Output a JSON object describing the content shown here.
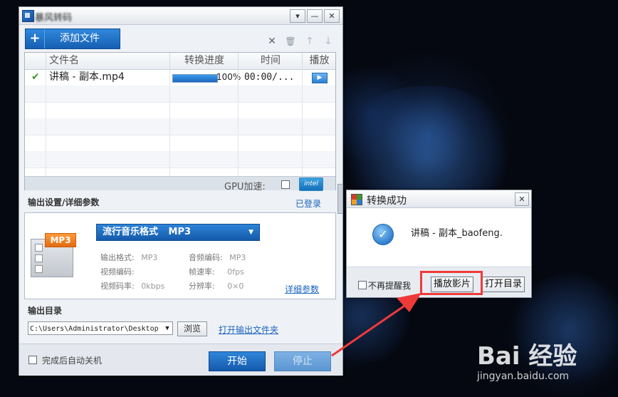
{
  "main_window": {
    "title": "暴风转码",
    "controls": {
      "menu": "▾",
      "minimize": "—",
      "close": "✕"
    },
    "toolbar": {
      "add_plus": "+",
      "add_label": "添加文件",
      "remove_icon": "✕",
      "delete_icon": "🗑",
      "up_icon": "↑",
      "down_icon": "↓"
    },
    "list": {
      "columns": [
        "文件名",
        "转换进度",
        "时间",
        "播放"
      ],
      "rows": [
        {
          "check": "✔",
          "filename": "讲稿 - 副本.mp4",
          "progress_percent": 100,
          "progress_label": "100%",
          "time": "00:00/...",
          "play": "▶"
        }
      ],
      "gpu_label": "GPU加速:",
      "gpu_checked": false,
      "intel_label": "intel"
    },
    "output_settings": {
      "title": "输出设置/详细参数",
      "login_link": "已登录",
      "format_name": "流行音乐格式",
      "format_code": "MP3",
      "format_arrow": "▼",
      "icon_tag": "MP3",
      "params": {
        "output_format_label": "输出格式:",
        "output_format_value": "MP3",
        "audio_codec_label": "音频编码:",
        "audio_codec_value": "MP3",
        "video_codec_label": "视频编码:",
        "video_codec_value": "",
        "frame_rate_label": "帧速率:",
        "frame_rate_value": "0fps",
        "video_bitrate_label": "视频码率:",
        "video_bitrate_value": "0kbps",
        "resolution_label": "分辨率:",
        "resolution_value": "0×0"
      },
      "detail_link": "详细参数"
    },
    "output_dir": {
      "title": "输出目录",
      "path": "C:\\Users\\Administrator\\Desktop",
      "dropdown_arrow": "▼",
      "browse": "浏览",
      "open_folder_link": "打开输出文件夹"
    },
    "footer": {
      "shutdown_label": "完成后自动关机",
      "start": "开始",
      "stop": "停止"
    }
  },
  "dialog": {
    "title": "转换成功",
    "close": "✕",
    "message": "讲稿 - 副本_baofeng.",
    "ok_glyph": "✓",
    "dont_remind": "不再提醒我",
    "play_video": "播放影片",
    "open_dir": "打开目录"
  },
  "watermark": {
    "brand": "Bai 经验",
    "url": "jingyan.baidu.com"
  },
  "colors": {
    "accent_blue": "#1b64c0",
    "highlight_red": "#ef3a3a",
    "success_green": "#3a9b2a"
  }
}
